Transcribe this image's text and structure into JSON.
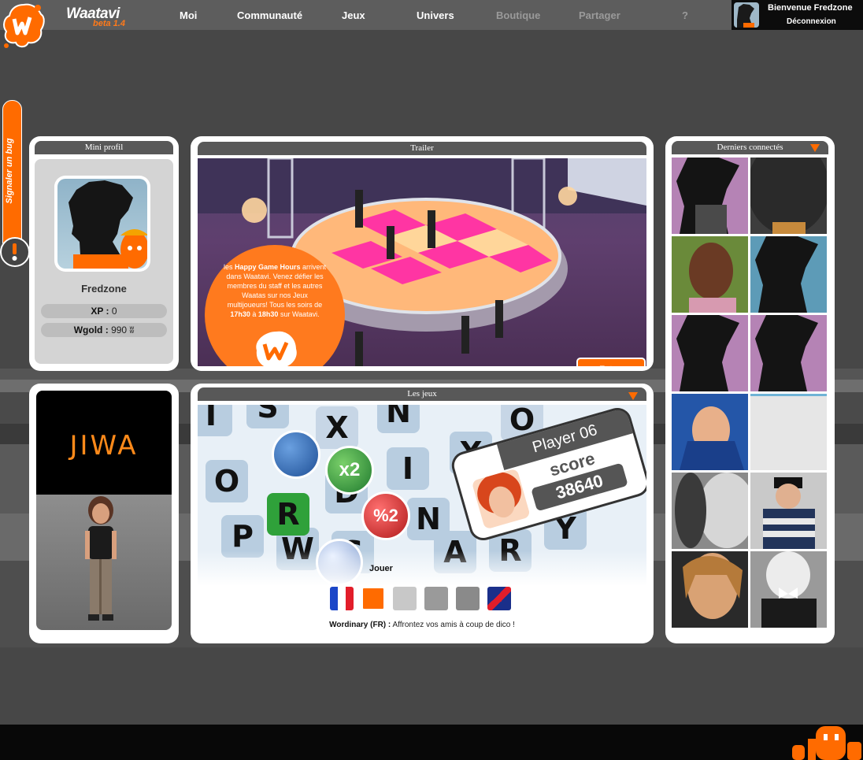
{
  "header": {
    "brand": "Waatavi",
    "beta": "beta",
    "beta_version": "1.4",
    "nav": [
      {
        "label": "Moi",
        "enabled": true
      },
      {
        "label": "Communauté",
        "enabled": true
      },
      {
        "label": "Jeux",
        "enabled": true
      },
      {
        "label": "Univers",
        "enabled": true
      },
      {
        "label": "Boutique",
        "enabled": false
      },
      {
        "label": "Partager",
        "enabled": false
      },
      {
        "label": "?",
        "enabled": false
      }
    ],
    "welcome": "Bienvenue Fredzone",
    "logout": "Déconnexion"
  },
  "bug_tab": {
    "label": "Signaler un bug",
    "icon": "warning-icon"
  },
  "mini_profile": {
    "title": "Mini profil",
    "username": "Fredzone",
    "xp_label": "XP :",
    "xp_value": "0",
    "wgold_label": "Wgold :",
    "wgold_value": "990"
  },
  "trailer": {
    "title": "Trailer",
    "promo_text_1": "les ",
    "promo_bold_1": "Happy Game Hours",
    "promo_text_2": " arrivent dans Waatavi. Venez défier les membres du staff et les autres Waatas sur nos Jeux multijoueurs! Tous les soirs de ",
    "promo_bold_2": "17h30",
    "promo_text_3": " à ",
    "promo_bold_3": "18h30",
    "promo_text_4": " sur Waatavi.",
    "enter_label": "Entrer"
  },
  "ad": {
    "brand": "JIWA"
  },
  "games": {
    "title": "Les jeux",
    "scene": {
      "player": "Player 06",
      "score_label": "score",
      "score_value": "38640",
      "bubble_x2": "x2",
      "bubble_pct2": "%2"
    },
    "play_label": "Jouer",
    "game_name": "Wordinary (FR) :",
    "game_desc": " Affrontez vos amis à coup de dico !"
  },
  "connected": {
    "title": "Derniers connectés"
  },
  "colors": {
    "accent": "#ff6b00",
    "header_bg": "#5d5d5d",
    "panel_head": "#585858"
  }
}
